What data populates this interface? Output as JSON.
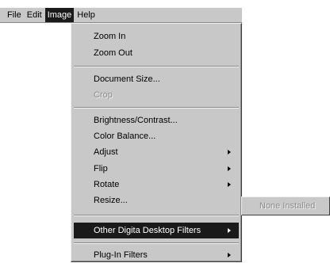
{
  "menubar": {
    "items": [
      {
        "label": "File"
      },
      {
        "label": "Edit"
      },
      {
        "label": "Image"
      },
      {
        "label": "Help"
      }
    ]
  },
  "image_menu": {
    "zoom_in": "Zoom In",
    "zoom_out": "Zoom Out",
    "document_size": "Document Size...",
    "crop": "Crop",
    "brightness_contrast": "Brightness/Contrast...",
    "color_balance": "Color Balance...",
    "adjust": "Adjust",
    "flip": "Flip",
    "rotate": "Rotate",
    "resize": "Resize...",
    "other_filters": "Other Digita Desktop Filters",
    "plugin_filters": "Plug-In Filters"
  },
  "submenu": {
    "none_installed": "None Installed"
  },
  "colors": {
    "menu_face": "#c8c8c8",
    "highlight": "#1a1a1a",
    "disabled_text": "#8c8c8c"
  }
}
